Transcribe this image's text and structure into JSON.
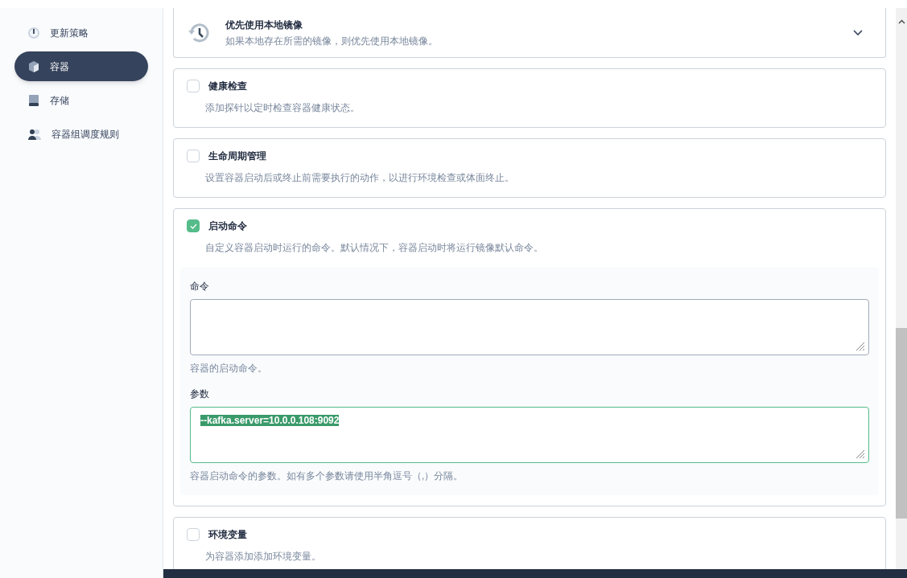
{
  "sidebar": {
    "items": [
      {
        "label": "更新策略",
        "selected": false
      },
      {
        "label": "容器",
        "selected": true
      },
      {
        "label": "存储",
        "selected": false
      },
      {
        "label": "容器组调度规则",
        "selected": false
      }
    ]
  },
  "sections": [
    {
      "kind": "select",
      "title": "优先使用本地镜像",
      "description": "如果本地存在所需的镜像，则优先使用本地镜像。",
      "expanded": false
    },
    {
      "kind": "checkbox",
      "title": "健康检查",
      "description": "添加探针以定时检查容器健康状态。",
      "checked": false
    },
    {
      "kind": "checkbox",
      "title": "生命周期管理",
      "description": "设置容器启动后或终止前需要执行的动作，以进行环境检查或体面终止。",
      "checked": false
    },
    {
      "kind": "checkbox",
      "title": "启动命令",
      "description": "自定义容器启动时运行的命令。默认情况下，容器启动时将运行镜像默认命令。",
      "checked": true,
      "fields": [
        {
          "label": "命令",
          "hint": "容器的启动命令。",
          "focused": false
        },
        {
          "label": "参数",
          "value": "--kafka.server=10.0.0.108:9092",
          "hint": "容器启动命令的参数。如有多个参数请使用半角逗号（,）分隔。",
          "focused": true
        }
      ]
    },
    {
      "kind": "checkbox",
      "title": "环境变量",
      "description": "为容器添加添加环境变量。",
      "checked": false
    }
  ]
}
